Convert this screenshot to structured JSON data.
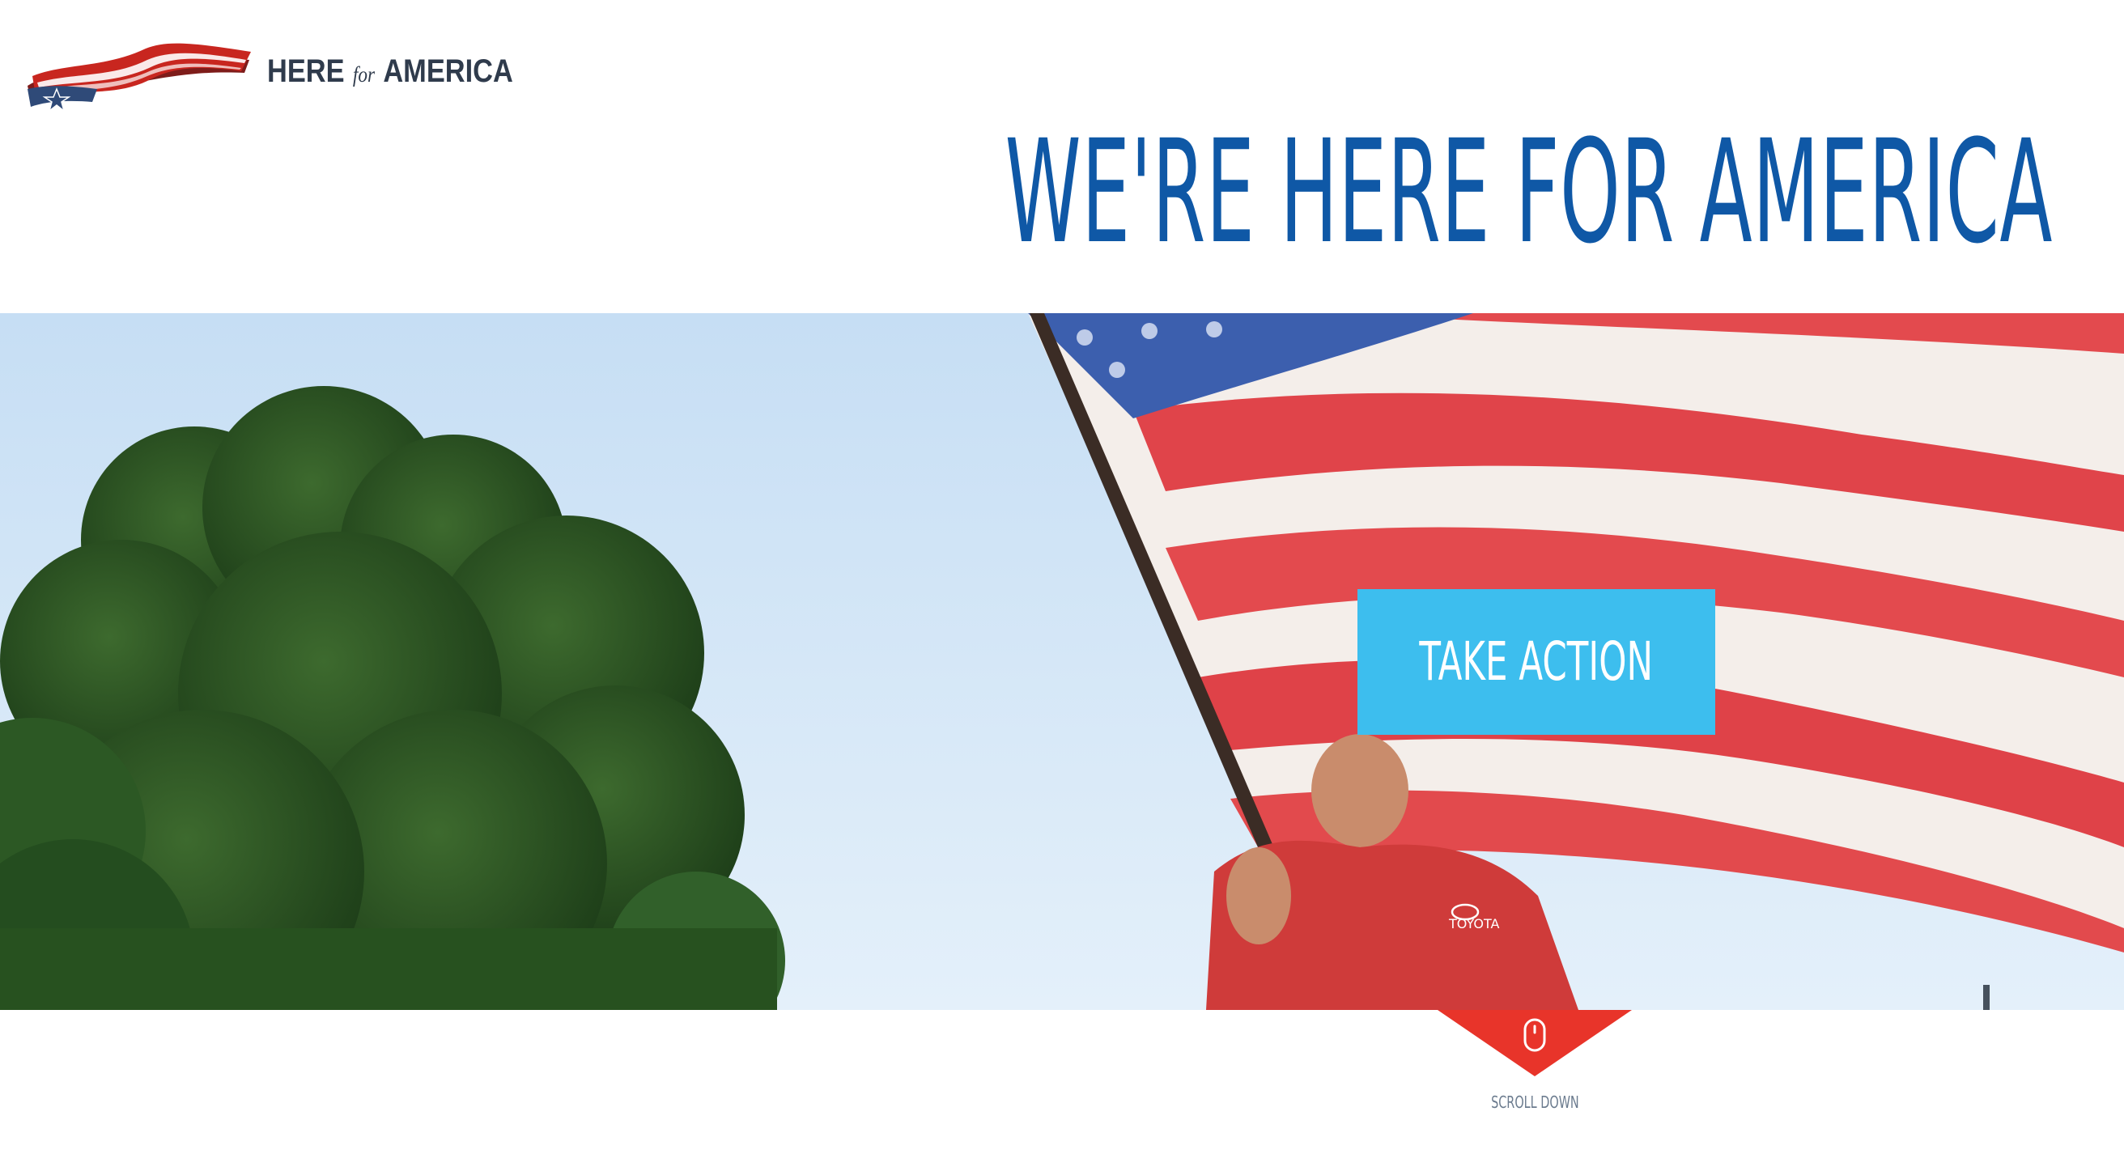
{
  "brand": {
    "logo_here": "HERE",
    "logo_for": "for",
    "logo_america": "AMERICA",
    "logo_icon": "flag-ribbon-star-icon",
    "colors": {
      "ribbon_red": "#c8261f",
      "ribbon_blue": "#2f4a78",
      "text_dark": "#2f3b4c"
    }
  },
  "header": {
    "title": "WE'RE HERE FOR AMERICA",
    "title_color": "#0f58a6"
  },
  "hero": {
    "cta_label": "TAKE ACTION",
    "cta_color": "#3dbeee"
  },
  "scroll": {
    "label": "SCROLL DOWN",
    "icon": "mouse-icon",
    "indicator_color": "#e8342a"
  }
}
